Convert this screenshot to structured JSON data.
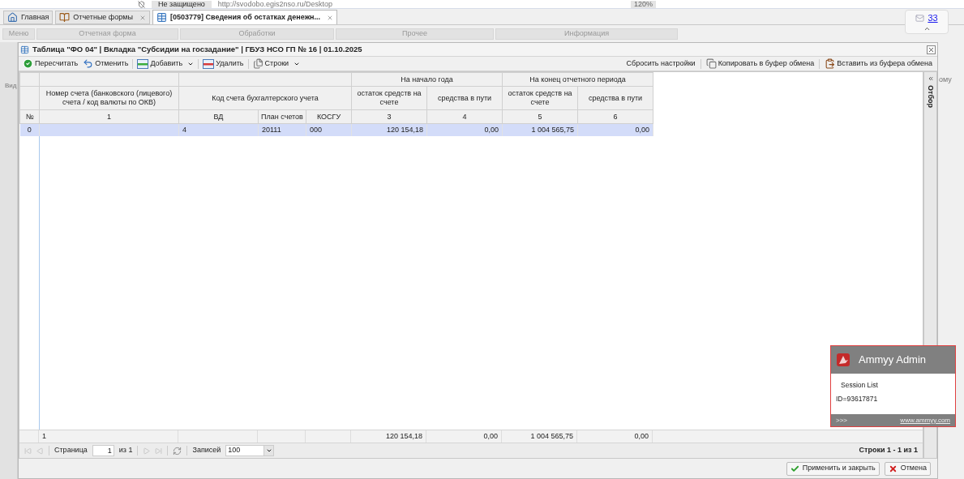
{
  "browser": {
    "security": "Не защищено",
    "url": "http://svodobo.egis2nso.ru/Desktop",
    "zoom": "120%"
  },
  "tabs": [
    {
      "label": "Главная",
      "selected": false,
      "closable": false,
      "kind": "home"
    },
    {
      "label": "Отчетные формы",
      "selected": false,
      "closable": true,
      "kind": "book"
    },
    {
      "label": "[0503779] Сведения об остатках денежн...",
      "selected": true,
      "closable": true,
      "kind": "table"
    }
  ],
  "ribbon": [
    "Меню",
    "Отчетная форма",
    "Обработки",
    "Прочее",
    "Информация"
  ],
  "notifications": {
    "count": "33"
  },
  "side_labels": {
    "left": "Вид",
    "right": "ому"
  },
  "dialog": {
    "title": "Таблица \"ФО 04\" | Вкладка \"Субсидии на госзадание\" | ГБУЗ НСО ГП № 16 | 01.10.2025",
    "toolbar_left": [
      {
        "label": "Пересчитать",
        "kind": "recalc",
        "dropdown": false
      },
      {
        "label": "Отменить",
        "kind": "undo",
        "dropdown": false
      },
      {
        "label": "Добавить",
        "kind": "add",
        "dropdown": true
      },
      {
        "label": "Удалить",
        "kind": "delete",
        "dropdown": false
      },
      {
        "label": "Строки",
        "kind": "rows",
        "dropdown": true
      }
    ],
    "toolbar_right": [
      {
        "label": "Сбросить настройки",
        "kind": "reset"
      },
      {
        "label": "Копировать в буфер обмена",
        "kind": "copy"
      },
      {
        "label": "Вставить из буфера обмена",
        "kind": "paste"
      }
    ],
    "table": {
      "account_col": "Номер счета (банковского (лицевого) счета / код валюты по ОКВ)",
      "code_col": "Код счета бухгалтерского учета",
      "groups": [
        "На начало года",
        "На конец отчетного периода"
      ],
      "sub_cols": [
        "остаток средств на счете",
        "средства в пути",
        "остаток средств на счете",
        "средства в пути"
      ],
      "number_row": [
        "№",
        "1",
        "ВД",
        "План счетов",
        "КОСГУ",
        "3",
        "4",
        "5",
        "6"
      ],
      "rows": [
        {
          "index": "0",
          "vd": "4",
          "plan": "20111",
          "kosgu": "000",
          "values": [
            "120 154,18",
            "0,00",
            "1 004 565,75",
            "0,00"
          ],
          "selected": true
        }
      ],
      "totals": {
        "count": "1",
        "values": [
          "120 154,18",
          "0,00",
          "1 004 565,75",
          "0,00"
        ]
      }
    },
    "side_panel": "Отбор",
    "pager": {
      "page_label": "Страница",
      "page": "1",
      "of": "из 1",
      "records_label": "Записей",
      "records": "100",
      "summary": "Строки 1 - 1 из 1"
    },
    "buttons": [
      {
        "label": "Применить и закрыть",
        "kind": "apply"
      },
      {
        "label": "Отмена",
        "kind": "cancel"
      }
    ]
  },
  "overlay": {
    "title": "Ammyy Admin",
    "session": "Session List",
    "id": "ID=93617871",
    "more": ">>>",
    "link": "www.ammyy.com"
  }
}
